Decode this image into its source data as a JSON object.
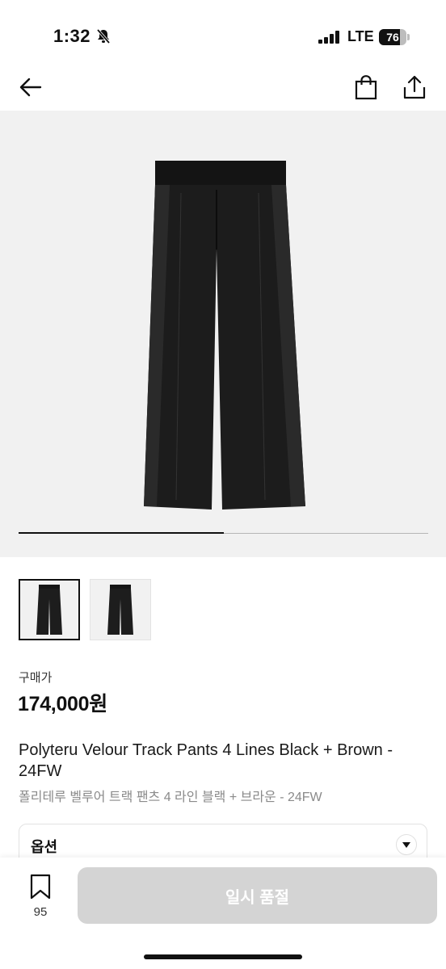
{
  "status_bar": {
    "time": "1:32",
    "network": "LTE",
    "battery": "76",
    "battery_level": 0.76,
    "icons": [
      "bell-slash-icon",
      "signal-bars-icon",
      "battery-icon"
    ]
  },
  "nav": {
    "icons": [
      "arrow-left-icon",
      "shopping-bag-icon",
      "share-icon"
    ]
  },
  "gallery": {
    "total_images": 2,
    "active_index": 0,
    "progress": 0.5
  },
  "price": {
    "label": "구매가",
    "value": "174,000원"
  },
  "product": {
    "name": "Polyteru Velour Track Pants 4 Lines Black + Brown - 24FW",
    "name_ko": "폴리테루 벨루어 트랙 팬츠 4 라인 블랙 + 브라운 - 24FW"
  },
  "option": {
    "label": "옵션"
  },
  "bottom_bar": {
    "bookmark_count": "95",
    "action_label": "일시 품절"
  },
  "colors": {
    "accent": "#111111",
    "hero_bg": "#f1f1f1",
    "disabled_button": "#d4d4d4"
  }
}
